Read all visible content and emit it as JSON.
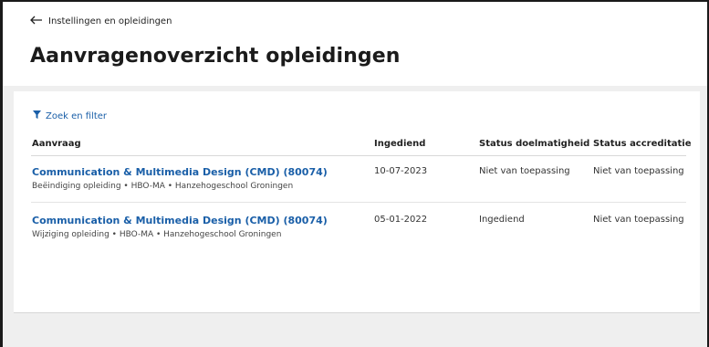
{
  "header": {
    "back_label": "Instellingen en opleidingen",
    "title": "Aanvragenoverzicht opleidingen"
  },
  "filter": {
    "label": "Zoek en filter"
  },
  "table": {
    "columns": [
      "Aanvraag",
      "Ingediend",
      "Status doelmatigheid",
      "Status accreditatie"
    ],
    "rows": [
      {
        "title": "Communication & Multimedia Design (CMD) (80074)",
        "subtitle": "Beëindiging opleiding • HBO-MA • Hanzehogeschool Groningen",
        "date": "10-07-2023",
        "status_doelmatigheid": "Niet van toepassing",
        "status_accreditatie": "Niet van toepassing"
      },
      {
        "title": "Communication & Multimedia Design (CMD) (80074)",
        "subtitle": "Wijziging opleiding • HBO-MA • Hanzehogeschool Groningen",
        "date": "05-01-2022",
        "status_doelmatigheid": "Ingediend",
        "status_accreditatie": "Niet van toepassing"
      }
    ]
  },
  "colors": {
    "link": "#1a5fa8",
    "background": "#efefef"
  },
  "icons": {
    "back": "arrow-left-icon",
    "filter": "funnel-icon"
  }
}
